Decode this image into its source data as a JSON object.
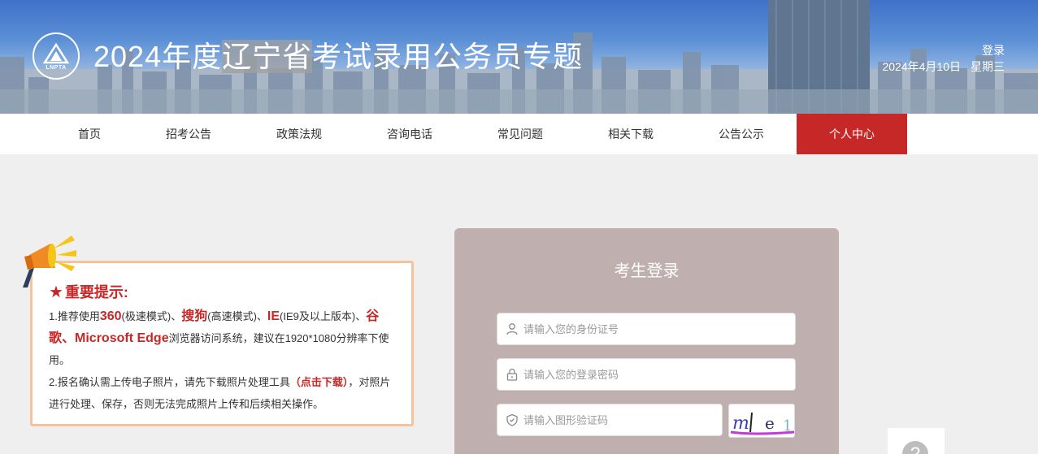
{
  "header": {
    "logo_text": "LNPTA",
    "title_pre": "2024年度",
    "title_highlight": "辽宁省",
    "title_post": "考试录用公务员专题",
    "login_link": "登录",
    "date": "2024年4月10日",
    "weekday": "星期三"
  },
  "nav": {
    "items": [
      "首页",
      "招考公告",
      "政策法规",
      "咨询电话",
      "常见问题",
      "相关下载",
      "公告公示",
      "个人中心"
    ],
    "active_index": 7
  },
  "notice": {
    "title": "重要提示:",
    "l1_a": "1.推荐使用",
    "b360": "360",
    "l1_b": "(极速模式)、",
    "sogou": "搜狗",
    "l1_c": "(高速模式)、",
    "ie": "IE",
    "l1_d": "(IE9及以上版本)、",
    "google": "谷歌",
    "sep": "、",
    "edge": "Microsoft Edge",
    "l1_e": "浏览器访问系统，建议在1920*1080分辨率下使用。",
    "l2_a": "2.报名确认需上传电子照片，请先下载照片处理工具",
    "download_link": "（点击下载）",
    "l2_b": "，对照片进行处理、保存，否则无法完成照片上传和后续相关操作。"
  },
  "login": {
    "title": "考生登录",
    "id_placeholder": "请输入您的身份证号",
    "password_placeholder": "请输入您的登录密码",
    "captcha_placeholder": "请输入图形验证码",
    "captcha_text": "m|e1"
  },
  "help": {
    "symbol": "?"
  },
  "colors": {
    "accent_red": "#c62828",
    "login_panel": "#c0afaf",
    "notice_border": "#f4c29c"
  }
}
